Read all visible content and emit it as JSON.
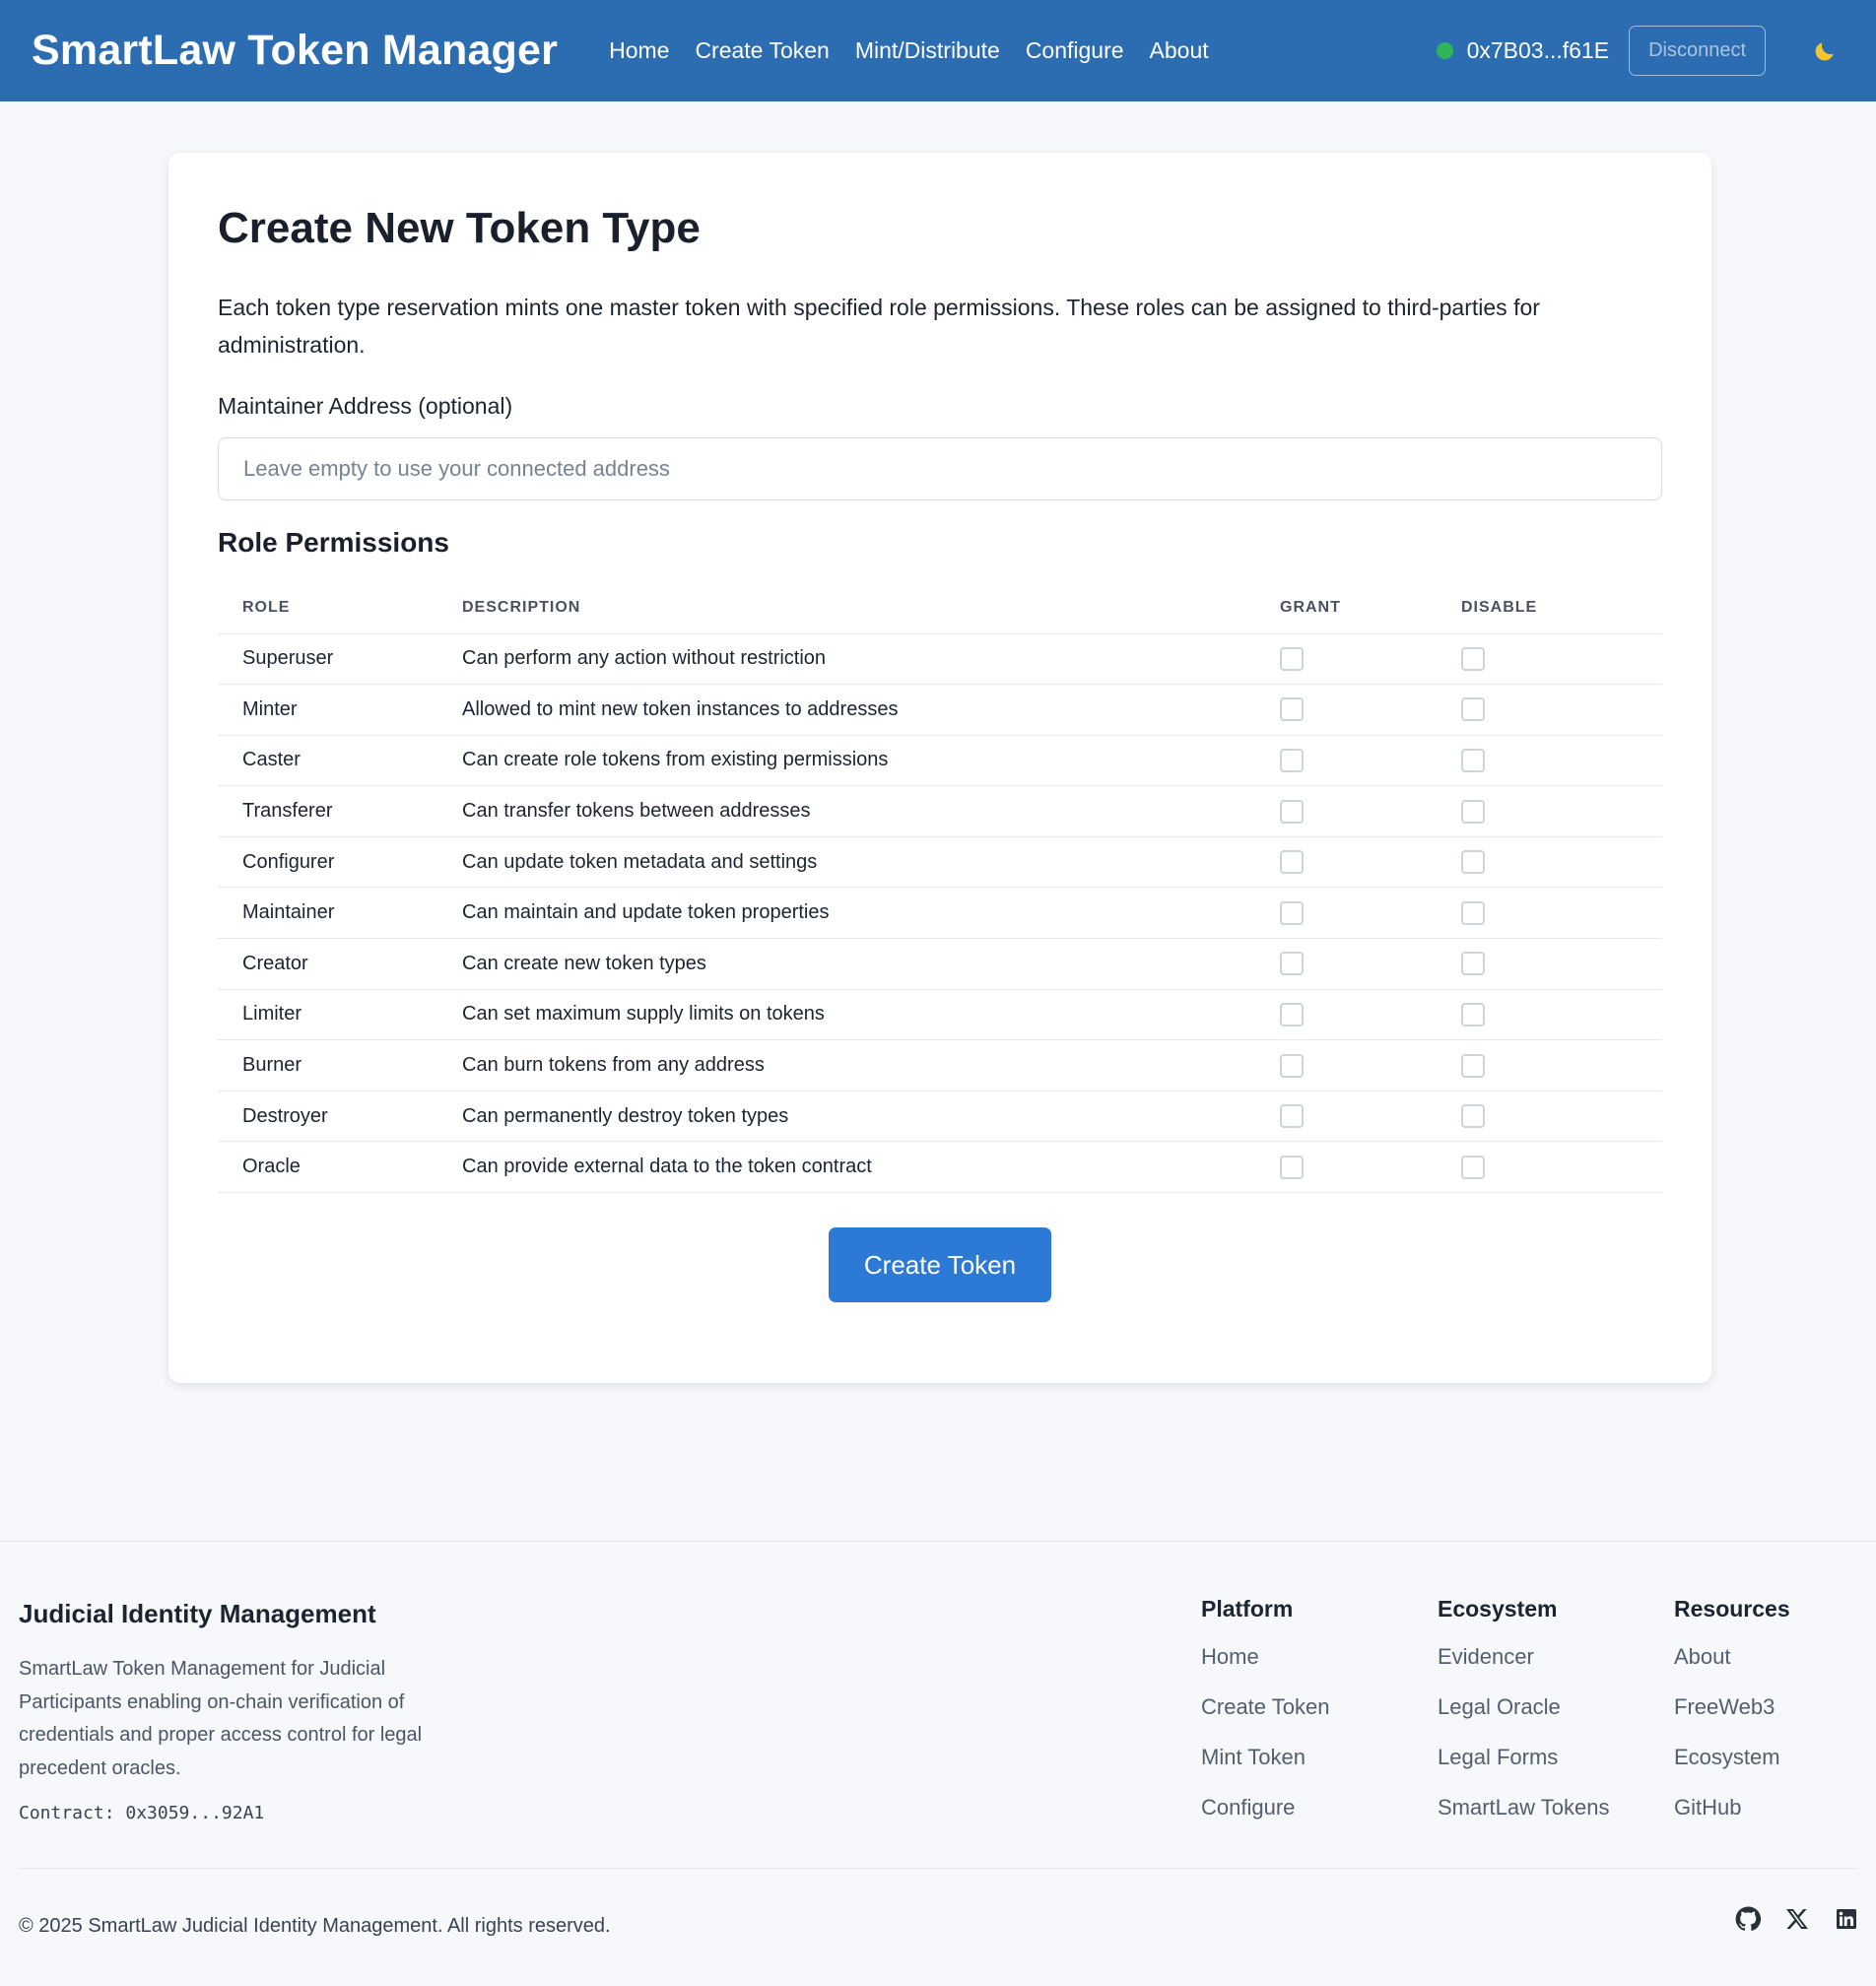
{
  "header": {
    "brand": "SmartLaw Token Manager",
    "nav": [
      "Home",
      "Create Token",
      "Mint/Distribute",
      "Configure",
      "About"
    ],
    "wallet_address": "0x7B03...f61E",
    "wallet_status_color": "#2fb35b",
    "disconnect_label": "Disconnect",
    "theme_icon": "moon-icon",
    "background_color": "#2c6cb0"
  },
  "main": {
    "title": "Create New Token Type",
    "intro": "Each token type reservation mints one master token with specified role permissions. These roles can be assigned to third-parties for administration.",
    "maintainer_label": "Maintainer Address (optional)",
    "maintainer_placeholder": "Leave empty to use your connected address",
    "maintainer_value": "",
    "roles_heading": "Role Permissions",
    "columns": {
      "role": "ROLE",
      "description": "DESCRIPTION",
      "grant": "GRANT",
      "disable": "DISABLE"
    },
    "roles": [
      {
        "role": "Superuser",
        "description": "Can perform any action without restriction",
        "grant": false,
        "disable": false
      },
      {
        "role": "Minter",
        "description": "Allowed to mint new token instances to addresses",
        "grant": false,
        "disable": false
      },
      {
        "role": "Caster",
        "description": "Can create role tokens from existing permissions",
        "grant": false,
        "disable": false
      },
      {
        "role": "Transferer",
        "description": "Can transfer tokens between addresses",
        "grant": false,
        "disable": false
      },
      {
        "role": "Configurer",
        "description": "Can update token metadata and settings",
        "grant": false,
        "disable": false
      },
      {
        "role": "Maintainer",
        "description": "Can maintain and update token properties",
        "grant": false,
        "disable": false
      },
      {
        "role": "Creator",
        "description": "Can create new token types",
        "grant": false,
        "disable": false
      },
      {
        "role": "Limiter",
        "description": "Can set maximum supply limits on tokens",
        "grant": false,
        "disable": false
      },
      {
        "role": "Burner",
        "description": "Can burn tokens from any address",
        "grant": false,
        "disable": false
      },
      {
        "role": "Destroyer",
        "description": "Can permanently destroy token types",
        "grant": false,
        "disable": false
      },
      {
        "role": "Oracle",
        "description": "Can provide external data to the token contract",
        "grant": false,
        "disable": false
      }
    ],
    "create_button": "Create Token",
    "accent_color": "#2c7ad6"
  },
  "footer": {
    "title": "Judicial Identity Management",
    "description": "SmartLaw Token Management for Judicial Participants enabling on-chain verification of credentials and proper access control for legal precedent oracles.",
    "contract": "Contract: 0x3059...92A1",
    "columns": [
      {
        "heading": "Platform",
        "links": [
          "Home",
          "Create Token",
          "Mint Token",
          "Configure"
        ]
      },
      {
        "heading": "Ecosystem",
        "links": [
          "Evidencer",
          "Legal Oracle",
          "Legal Forms",
          "SmartLaw Tokens"
        ]
      },
      {
        "heading": "Resources",
        "links": [
          "About",
          "FreeWeb3",
          "Ecosystem",
          "GitHub"
        ]
      }
    ],
    "copyright": "© 2025 SmartLaw Judicial Identity Management. All rights reserved.",
    "socials": [
      "github-icon",
      "x-icon",
      "linkedin-icon"
    ]
  }
}
